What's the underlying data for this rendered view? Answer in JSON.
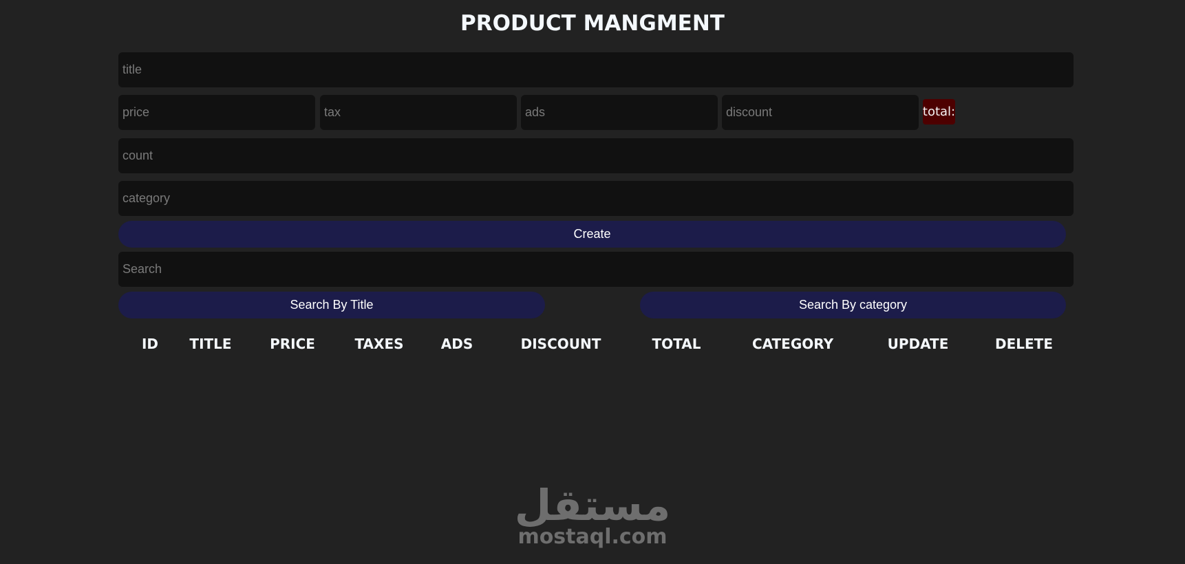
{
  "header": {
    "title": "PRODUCT MANGMENT"
  },
  "form": {
    "title_placeholder": "title",
    "price_placeholder": "price",
    "tax_placeholder": "tax",
    "ads_placeholder": "ads",
    "discount_placeholder": "discount",
    "total_label": "total:",
    "count_placeholder": "count",
    "category_placeholder": "category",
    "create_label": "Create"
  },
  "search": {
    "placeholder": "Search",
    "by_title_label": "Search By Title",
    "by_category_label": "Search By category"
  },
  "table": {
    "headers": [
      "ID",
      "TITLE",
      "PRICE",
      "TAXES",
      "ADS",
      "DISCOUNT",
      "TOTAL",
      "CATEGORY",
      "UPDATE",
      "DELETE"
    ]
  },
  "watermark": {
    "arabic": "مستقل",
    "latin": "mostaql.com"
  },
  "colors": {
    "background": "#222222",
    "input": "#111111",
    "button": "#1c1c4a",
    "total": "#4d0000"
  }
}
